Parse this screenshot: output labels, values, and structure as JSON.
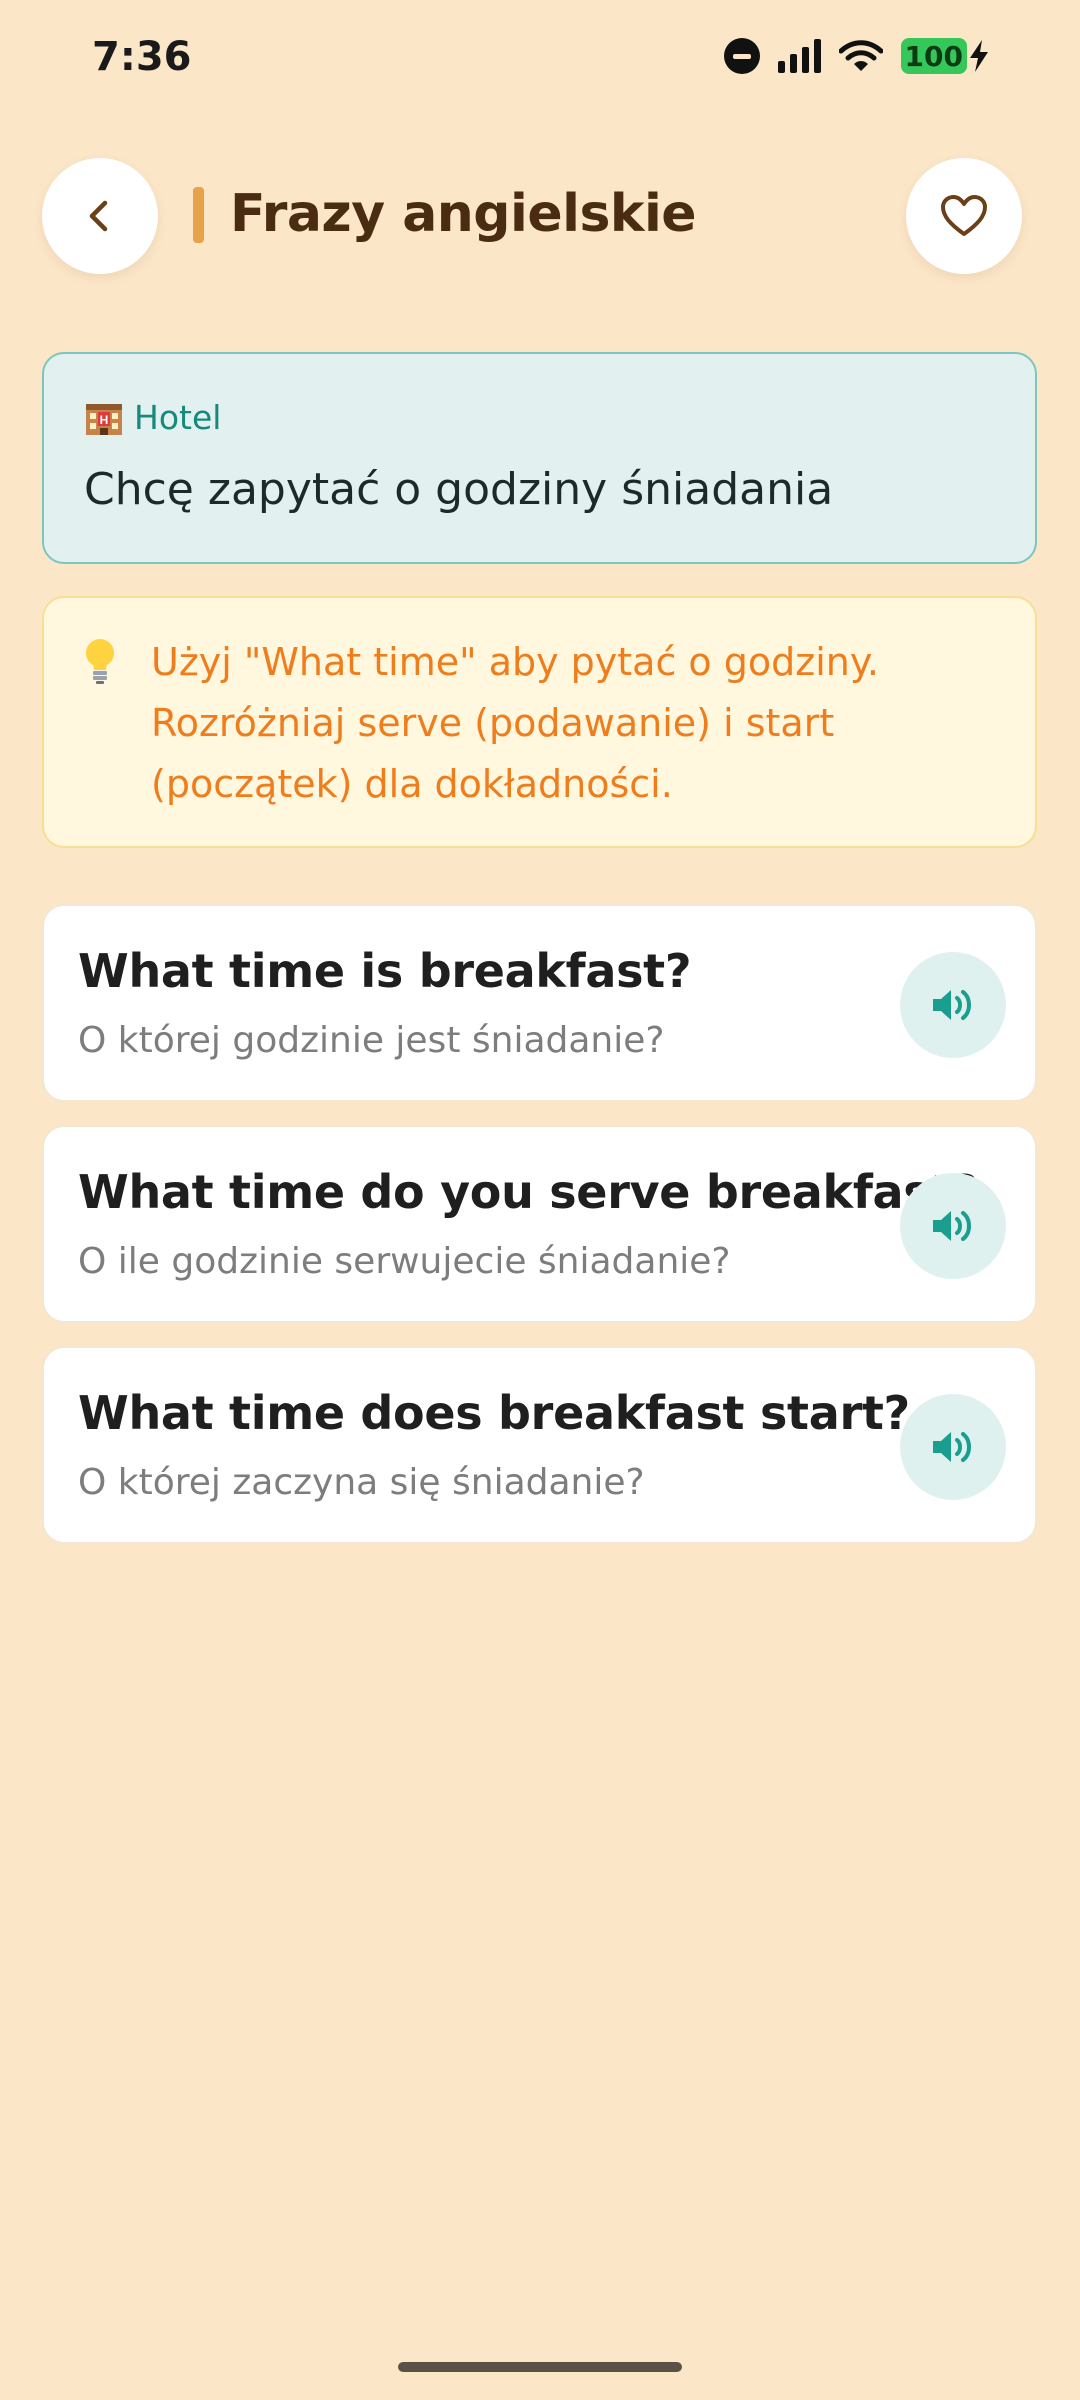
{
  "status_bar": {
    "time": "7:36",
    "battery": "100"
  },
  "header": {
    "title": "Frazy angielskie",
    "back_icon": "chevron-left-icon",
    "favorite_icon": "heart-outline-icon"
  },
  "context": {
    "category": "Hotel",
    "category_icon": "hotel-icon",
    "text": "Chcę zapytać o godziny śniadania"
  },
  "tip": {
    "icon": "lightbulb-icon",
    "text": "Użyj \"What time\" aby pytać o godziny. Rozróżniaj serve (podawanie) i start (początek) dla dokładności."
  },
  "phrases": [
    {
      "en": "What time is breakfast?",
      "pl": "O której godzinie jest śniadanie?",
      "icon": "speaker-icon"
    },
    {
      "en": "What time do you serve breakfast?",
      "pl": "O ile godzinie serwujecie śniadanie?",
      "icon": "speaker-icon"
    },
    {
      "en": "What time does breakfast start?",
      "pl": "O której zaczyna się śniadanie?",
      "icon": "speaker-icon"
    }
  ],
  "colors": {
    "background": "#fbe6c8",
    "accent": "#e8a24a",
    "teal": "#1a9e8f",
    "tip_text": "#ef7d1c"
  }
}
